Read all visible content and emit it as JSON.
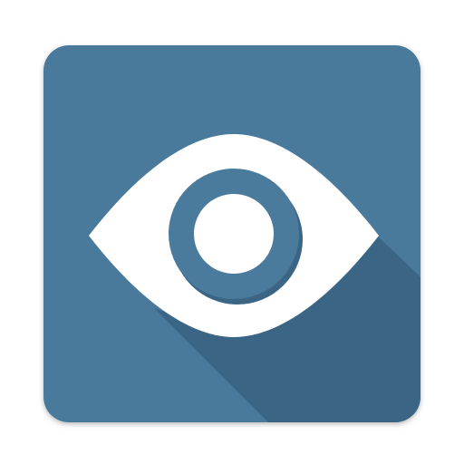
{
  "app_icon": {
    "name": "eye-icon",
    "colors": {
      "tile": "#4a7a9c",
      "long_shadow": "#3a6585",
      "eye_white": "#ffffff",
      "iris_ring": "#4a7a9c",
      "iris_ring_shadow": "#3a6585",
      "pupil": "#ffffff",
      "page_background": "#ffffff"
    }
  }
}
